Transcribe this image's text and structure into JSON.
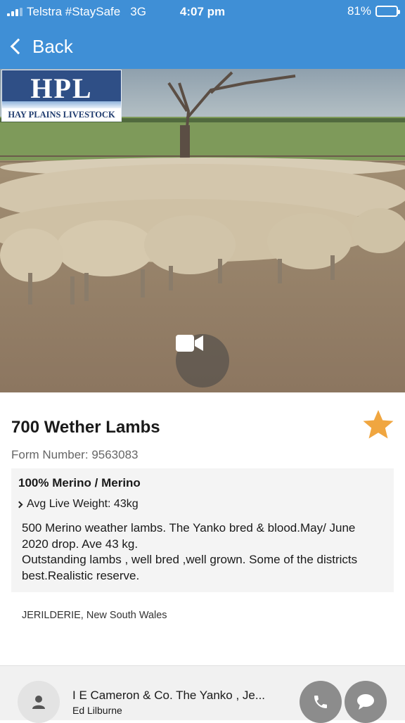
{
  "status_bar": {
    "carrier": "Telstra #StaySafe",
    "network": "3G",
    "time": "4:07 pm",
    "battery_text": "81%",
    "battery_level": 0.81
  },
  "nav": {
    "back_label": "Back"
  },
  "hero": {
    "logo": {
      "title": "HPL",
      "subtitle": "HAY PLAINS LIVESTOCK"
    },
    "video_icon": "video-camera-icon"
  },
  "listing": {
    "title": "700 Wether Lambs",
    "favorite_icon": "star-icon",
    "favorite_color": "#f0a640",
    "form_number_label": "Form Number:",
    "form_number": "9563083",
    "breed": "100% Merino / Merino",
    "avg_weight": "Avg Live Weight: 43kg",
    "description": "500 Merino weather lambs. The Yanko bred & blood.May/ June 2020 drop. Ave 43 kg.\nOutstanding lambs , well bred ,well grown. Some of the districts best.Realistic reserve.",
    "location": "JERILDERIE, New South Wales"
  },
  "agent": {
    "name": "I E Cameron & Co. The Yanko , Je...",
    "contact": "Ed Lilburne",
    "avatar_icon": "person-icon",
    "call_icon": "phone-icon",
    "chat_icon": "chat-bubble-icon"
  },
  "colors": {
    "header_blue": "#3f8fd6",
    "button_grey": "#8c8c8c"
  }
}
